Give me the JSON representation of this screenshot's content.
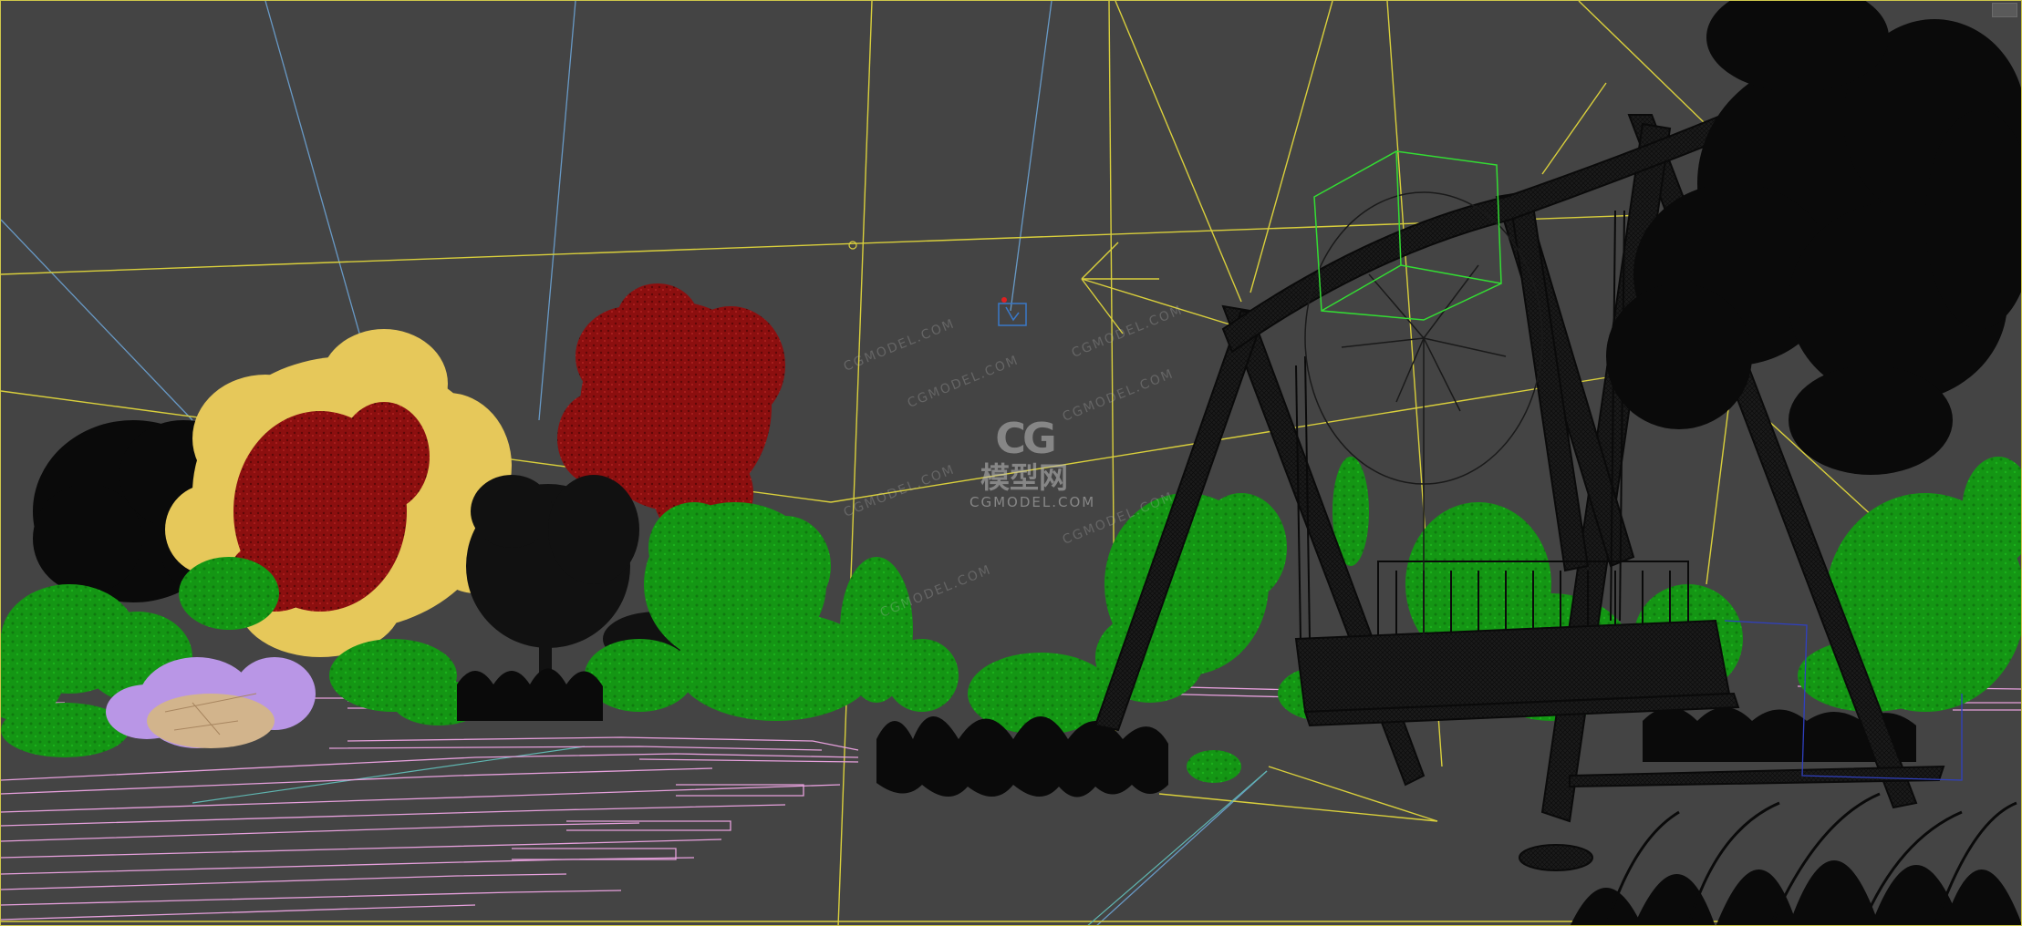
{
  "viewport": {
    "background": "#444444",
    "frame_color": "#cfc74a"
  },
  "watermark": {
    "glyph": "CG",
    "name_cn": "模型网",
    "name_en": "CGMODEL.COM",
    "repeat_text": "CGMODEL.COM"
  },
  "colors": {
    "camera_lines": "#d9cf3c",
    "helper_lines_blue": "#6fa8dc",
    "helper_lines_cyan": "#5fb5b0",
    "foliage_green": "#149614",
    "foliage_yellow": "#e6c85a",
    "foliage_red": "#8c0f0f",
    "foliage_black": "#0a0a0a",
    "flowers_lilac": "#b996e6",
    "rock_tan": "#d2b48c",
    "pavement_pink": "#e6a0dc",
    "swing_wireframe": "#121212",
    "selection_box": "#33dd33",
    "light_icon": "#3a78c8"
  },
  "objects": [
    {
      "name": "swing",
      "icon": "swing-wireframe"
    },
    {
      "name": "tree-yellow",
      "icon": "tree"
    },
    {
      "name": "tree-red",
      "icon": "tree"
    },
    {
      "name": "tree-black-left",
      "icon": "tree"
    },
    {
      "name": "tree-black-right",
      "icon": "tree"
    },
    {
      "name": "camera-target",
      "icon": "target-box"
    },
    {
      "name": "light",
      "icon": "light-helper"
    }
  ]
}
